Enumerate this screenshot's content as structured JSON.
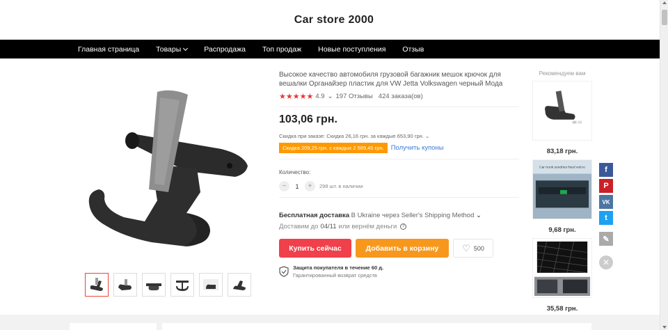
{
  "store": {
    "title": "Car store 2000"
  },
  "nav": [
    {
      "label": "Главная страница"
    },
    {
      "label": "Товары",
      "has_caret": true
    },
    {
      "label": "Распродажа"
    },
    {
      "label": "Топ продаж"
    },
    {
      "label": "Новые поступления"
    },
    {
      "label": "Отзыв"
    }
  ],
  "product": {
    "title": "Высокое качество автомобиля грузовой багажник мешок крючок для вешалки Органайзер пластик для VW Jetta Volkswagen черный Мода",
    "stars": "★★★★★",
    "rating": "4.9",
    "reviews": "197 Отзывы",
    "orders": "424 заказа(ов)",
    "price": "103,06 грн.",
    "discount_text": "Скидка при заказе: Скидка 26,16 грн. за каждые 653,90 грн.",
    "coupon_text": "Скидка 209,25 грн. с каждых 2 589,45 грн.",
    "coupon_link": "Получить купоны",
    "quantity_label": "Количество:",
    "quantity": "1",
    "stock": "298 шт. в наличии",
    "shipping_bold": "Бесплатная доставка",
    "shipping_rest": "В Ukraine через Seller's Shipping Method",
    "delivery_prefix": "Доставим до",
    "delivery_date": "04/11",
    "delivery_suffix": "или вернём деньги",
    "buy_label": "Купить сейчас",
    "cart_label": "Добавить в корзину",
    "wish_count": "500",
    "protection_title": "Защита покупателя в течение 60 д.",
    "protection_sub": "Гарантированный возврат средств",
    "thumbnail_count": 6
  },
  "recommend": {
    "title": "Рекомендуем вам",
    "items": [
      {
        "price": "83,18 грн."
      },
      {
        "price": "9,68 грн.",
        "image_caption": "Car trunk sundries fixed velcro"
      },
      {
        "price": "35,58 грн."
      }
    ]
  },
  "social": {
    "fb": "f",
    "pin": "P",
    "vk": "VK",
    "tw": "t",
    "close": "✕"
  },
  "colors": {
    "accent_red": "#f0404b",
    "accent_orange": "#f7981d",
    "link_blue": "#3a7bd5",
    "nav_bg": "#000000"
  }
}
